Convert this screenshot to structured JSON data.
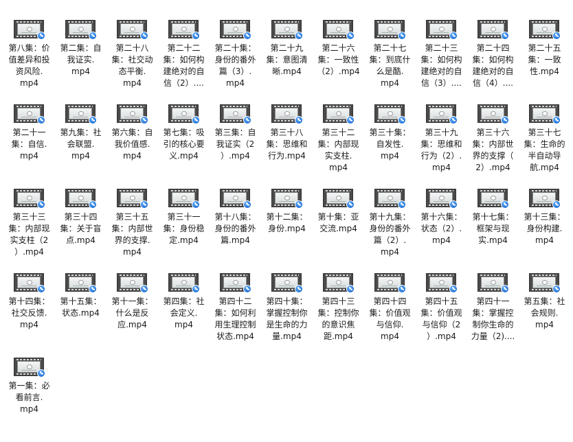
{
  "files": [
    {
      "name": "第八集：价值差异和投资风险.mp4",
      "display": "第八集：价\n值差异和投\n资风险.\nmp4"
    },
    {
      "name": "第二集：自我证实.mp4",
      "display": "第二集：自\n我证实.\nmp4"
    },
    {
      "name": "第二十八集：社交动态平衡.mp4",
      "display": "第二十八\n集：社交动\n态平衡.\nmp4"
    },
    {
      "name": "第二十二集：如何构建绝对的自信（2）....",
      "display": "第二十二\n集：如何构\n建绝对的自\n信（2）...."
    },
    {
      "name": "第二十集：身份的番外篇（3）.mp4",
      "display": "第二十集：\n身份的番外\n篇（3）.\nmp4"
    },
    {
      "name": "第二十九集：意图清晰.mp4",
      "display": "第二十九\n集：意图清\n晰.mp4"
    },
    {
      "name": "第二十六集：一致性（2）.mp4",
      "display": "第二十六\n集：一致性\n（2）.mp4"
    },
    {
      "name": "第二十七集：到底什么是酷.mp4",
      "display": "第二十七\n集：到底什\n么是酷.\nmp4"
    },
    {
      "name": "第二十三集：如何构建绝对的自信（3）....",
      "display": "第二十三\n集：如何构\n建绝对的自\n信（3）...."
    },
    {
      "name": "第二十四集：如何构建绝对的自信（4）....",
      "display": "第二十四\n集：如何构\n建绝对的自\n信（4）...."
    },
    {
      "name": "第二十五集：一致性.mp4",
      "display": "第二十五\n集：一致\n性.mp4"
    },
    {
      "name": "第二十一集：自信.mp4",
      "display": "第二十一\n集：自信.\nmp4"
    },
    {
      "name": "第九集：社会联盟.mp4",
      "display": "第九集：社\n会联盟.\nmp4"
    },
    {
      "name": "第六集：自我价值感.mp4",
      "display": "第六集：自\n我价值感.\nmp4"
    },
    {
      "name": "第七集：吸引的核心要义.mp4",
      "display": "第七集：吸\n引的核心要\n义.mp4"
    },
    {
      "name": "第三集：自我证实（2）.mp4",
      "display": "第三集：自\n我证实（2\n）.mp4"
    },
    {
      "name": "第三十八集：思维和行为.mp4",
      "display": "第三十八\n集：思维和\n行为.mp4"
    },
    {
      "name": "第三十二集：内部现实支柱.mp4",
      "display": "第三十二\n集：内部现\n实支柱.\nmp4"
    },
    {
      "name": "第三十集：自发性.mp4",
      "display": "第三十集：\n自发性.\nmp4"
    },
    {
      "name": "第三十九集：思维和行为（2）.mp4",
      "display": "第三十九\n集：思维和\n行为（2）.\nmp4"
    },
    {
      "name": "第三十六集：内部世界的支撑（2）.mp4",
      "display": "第三十六\n集：内部世\n界的支撑（\n2）.mp4"
    },
    {
      "name": "第三十七集：生命的半自动导航.mp4",
      "display": "第三十七\n集：生命的\n半自动导\n航.mp4"
    },
    {
      "name": "第三十三集：内部现实支柱（2）.mp4",
      "display": "第三十三\n集：内部现\n实支柱（2\n）.mp4"
    },
    {
      "name": "第三十四集：关于盲点.mp4",
      "display": "第三十四\n集：关于盲\n点.mp4"
    },
    {
      "name": "第三十五集：内部世界的支撑.mp4",
      "display": "第三十五\n集：内部世\n界的支撑.\nmp4"
    },
    {
      "name": "第三十一集：身份稳定.mp4",
      "display": "第三十一\n集：身份稳\n定.mp4"
    },
    {
      "name": "第十八集：身份的番外篇.mp4",
      "display": "第十八集：\n身份的番外\n篇.mp4"
    },
    {
      "name": "第十二集：身份.mp4",
      "display": "第十二集：\n身份.mp4"
    },
    {
      "name": "第十集：亚交流.mp4",
      "display": "第十集：亚\n交流.mp4"
    },
    {
      "name": "第十九集：身份的番外篇（2）.mp4",
      "display": "第十九集：\n身份的番外\n篇（2）.\nmp4"
    },
    {
      "name": "第十六集：状态（2）.mp4",
      "display": "第十六集：\n状态（2）.\nmp4"
    },
    {
      "name": "第十七集：框架与现实.mp4",
      "display": "第十七集：\n框架与现\n实.mp4"
    },
    {
      "name": "第十三集：身份构建.mp4",
      "display": "第十三集：\n身份构建.\nmp4"
    },
    {
      "name": "第十四集：社交反馈.mp4",
      "display": "第十四集：\n社交反馈.\nmp4"
    },
    {
      "name": "第十五集：状态.mp4",
      "display": "第十五集：\n状态.mp4"
    },
    {
      "name": "第十一集：什么是反应.mp4",
      "display": "第十一集：\n什么是反\n应.mp4"
    },
    {
      "name": "第四集：社会定义.mp4",
      "display": "第四集：社\n会定义.\nmp4"
    },
    {
      "name": "第四十二集：如何利用生理控制状态.mp4",
      "display": "第四十二\n集：如何利\n用生理控制\n状态.mp4"
    },
    {
      "name": "第四十集：掌握控制你是生命的力量.mp4",
      "display": "第四十集：\n掌握控制你\n是生命的力\n量.mp4"
    },
    {
      "name": "第四十三集：控制你的意识焦距.mp4",
      "display": "第四十三\n集：控制你\n的意识焦\n距.mp4"
    },
    {
      "name": "第四十四集：价值观与信仰.mp4",
      "display": "第四十四\n集：价值观\n与信仰.\nmp4"
    },
    {
      "name": "第四十五集：价值观与信仰（2）.mp4",
      "display": "第四十五\n集：价值观\n与信仰（2\n）.mp4"
    },
    {
      "name": "第四十一集：掌握控制你生命的力量（2)....",
      "display": "第四十一\n集：掌握控\n制你生命的\n力量（2)...."
    },
    {
      "name": "第五集：社会规则.mp4",
      "display": "第五集：社\n会规则.\nmp4"
    },
    {
      "name": "第一集：必看前言.mp4",
      "display": "第一集：必\n看前言.\nmp4"
    }
  ],
  "icon": "video-file-icon",
  "colors": {
    "background": "#ffffff",
    "text": "#1a1a1a",
    "badge": "#1f6fd6"
  }
}
